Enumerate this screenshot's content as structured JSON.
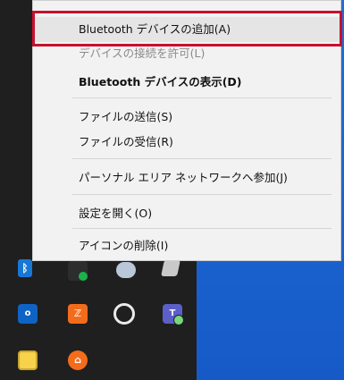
{
  "context_menu": {
    "items": [
      {
        "label": "Bluetooth デバイスの追加(A)",
        "state": "hovered"
      },
      {
        "label": "デバイスの接続を許可(L)",
        "state": "disabled"
      },
      {
        "label": "Bluetooth デバイスの表示(D)",
        "state": "default-bold"
      },
      {
        "label": "ファイルの送信(S)",
        "state": "enabled"
      },
      {
        "label": "ファイルの受信(R)",
        "state": "enabled"
      },
      {
        "label": "パーソナル エリア ネットワークへ参加(J)",
        "state": "enabled"
      },
      {
        "label": "設定を開く(O)",
        "state": "enabled"
      },
      {
        "label": "アイコンの削除(I)",
        "state": "enabled"
      }
    ]
  },
  "tray_icons": [
    {
      "name": "bluetooth-icon",
      "glyph": "ᛒ"
    },
    {
      "name": "security-shield-icon"
    },
    {
      "name": "cloud-icon"
    },
    {
      "name": "network-icon"
    },
    {
      "name": "outlook-icon",
      "glyph": "o"
    },
    {
      "name": "app-orange-icon",
      "glyph": "ℤ"
    },
    {
      "name": "circle-app-icon"
    },
    {
      "name": "teams-icon",
      "glyph": "T"
    },
    {
      "name": "keyboard-icon"
    },
    {
      "name": "app-orange-round-icon",
      "glyph": "⌂"
    }
  ],
  "colors": {
    "desktop_blue": "#1c66d2",
    "tray_panel": "#1f1f1f",
    "menu_bg": "#f2f2f2",
    "highlight_red": "#c8102e"
  }
}
